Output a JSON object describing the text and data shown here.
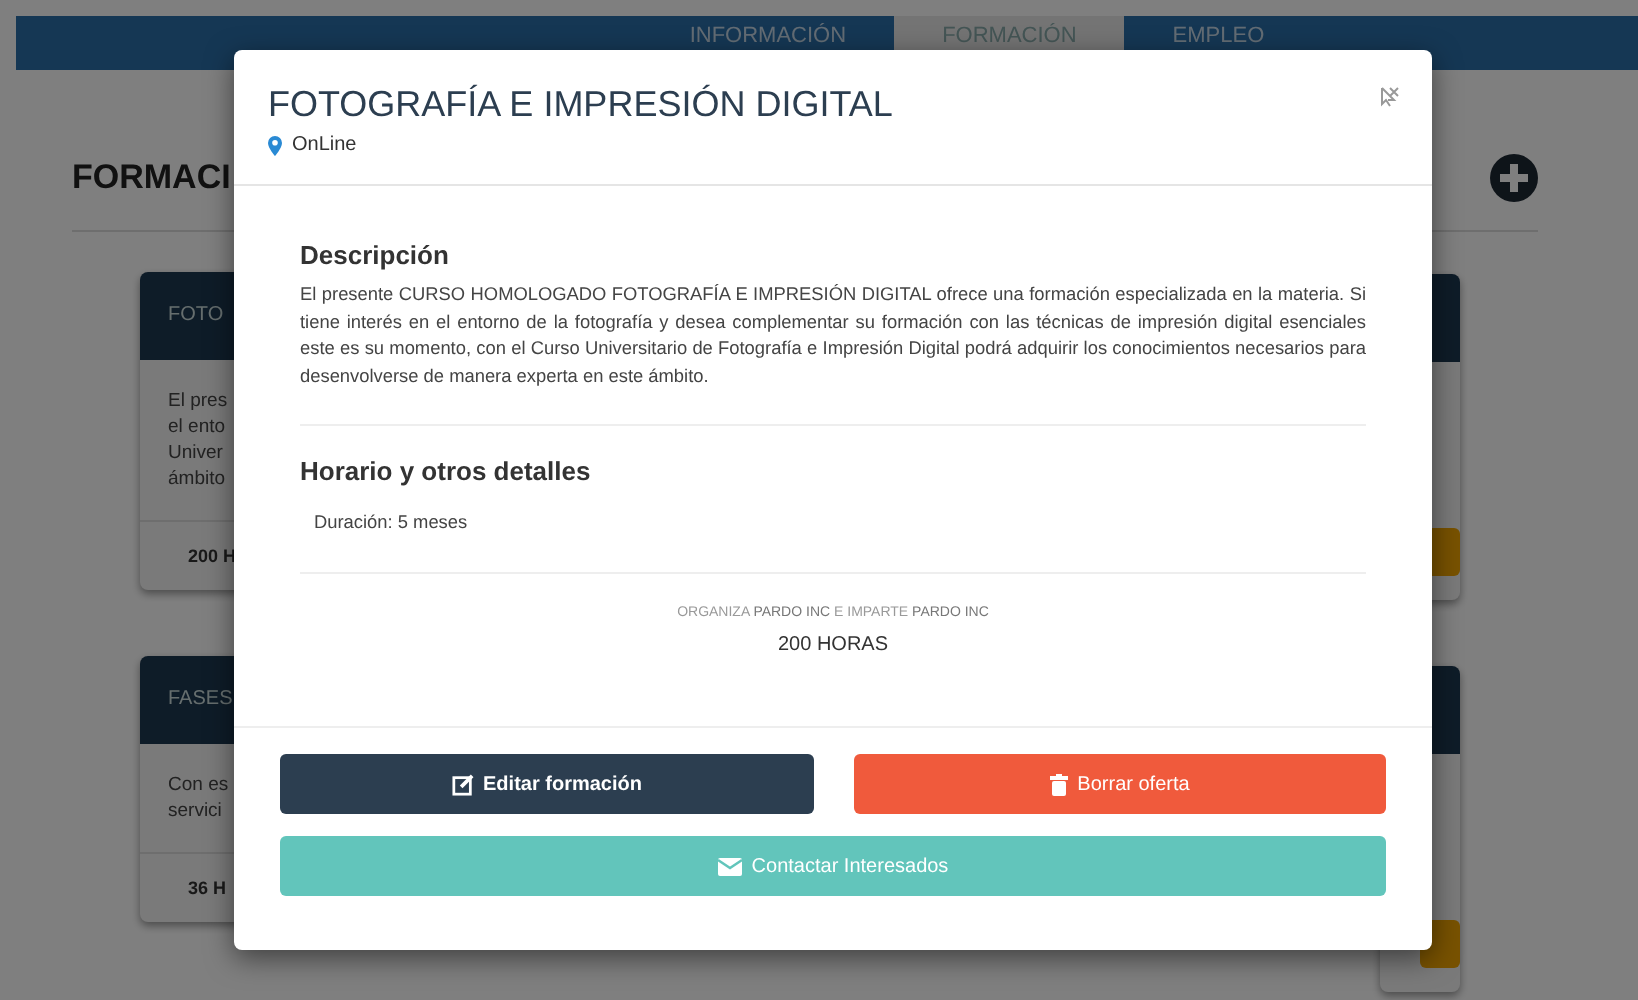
{
  "nav": {
    "tabs": [
      {
        "label": "INFORMACIÓN",
        "selected": false
      },
      {
        "label": "FORMACIÓN",
        "selected": true
      },
      {
        "label": "EMPLEO",
        "selected": false
      }
    ]
  },
  "page": {
    "title": "FORMACI",
    "cards": [
      {
        "title": "FOTO",
        "body_lines": [
          "El pres",
          "el ento",
          "Univer",
          "ámbito"
        ],
        "footer": "200 H"
      },
      {
        "title": "FASES",
        "body_lines": [
          "Con es",
          "servici"
        ],
        "footer": "36 H"
      }
    ]
  },
  "modal": {
    "title": "FOTOGRAFÍA E IMPRESIÓN DIGITAL",
    "location": "OnLine",
    "sections": [
      {
        "heading": "Descripción",
        "text": "El presente CURSO HOMOLOGADO FOTOGRAFÍA E IMPRESIÓN DIGITAL ofrece una formación especializada en la materia. Si tiene interés en el entorno de la fotografía y desea complementar su formación con las técnicas de impresión digital esenciales este es su momento, con el Curso Universitario de Fotografía e Impresión Digital podrá adquirir los conocimientos necesarios para desenvolverse de manera experta en este ámbito."
      },
      {
        "heading": "Horario y otros detalles",
        "text": "Duración: 5 meses"
      }
    ],
    "organizer": "ORGANIZA **PARDO INC** E IMPARTE **PARDO INC**",
    "hours": "200 HORAS",
    "buttons": [
      {
        "kind": "edit",
        "label": "Editar formación"
      },
      {
        "kind": "delete",
        "label": "Borrar oferta"
      },
      {
        "kind": "contact",
        "label": "Contactar Interesados"
      }
    ]
  }
}
